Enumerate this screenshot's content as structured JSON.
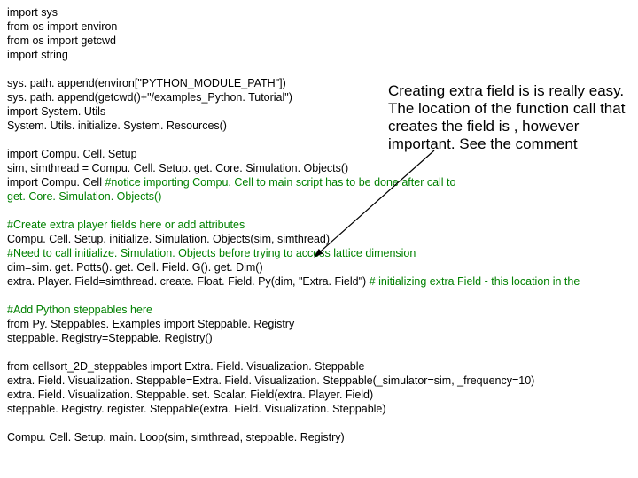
{
  "code": {
    "l1": "import sys",
    "l2": "from os import environ",
    "l3": "from os import getcwd",
    "l4": "import string",
    "l5": "",
    "l6": "sys. path. append(environ[\"PYTHON_MODULE_PATH\"])",
    "l7": "sys. path. append(getcwd()+\"/examples_Python. Tutorial\")",
    "l8": "import System. Utils",
    "l9": "System. Utils. initialize. System. Resources()",
    "l10": "",
    "l11": "import Compu. Cell. Setup",
    "l12": "sim, simthread = Compu. Cell. Setup. get. Core. Simulation. Objects()",
    "l13a": "import Compu. Cell ",
    "l13b": "#notice importing Compu. Cell to main script has to be done after call to ",
    "l14": "get. Core. Simulation. Objects()",
    "l15": "",
    "l16": "#Create extra player fields here or add attributes",
    "l17": "Compu. Cell. Setup. initialize. Simulation. Objects(sim, simthread)",
    "l18": "#Need to call initialize. Simulation. Objects before trying to access lattice dimension",
    "l19": "dim=sim. get. Potts(). get. Cell. Field. G(). get. Dim()",
    "l20a": "extra. Player. Field=simthread. create. Float. Field. Py(dim, \"Extra. Field\") ",
    "l20b": "# initializing extra Field - this location in the ",
    "l21": "",
    "l22": "#Add Python steppables here",
    "l23": "from Py. Steppables. Examples import Steppable. Registry",
    "l24": "steppable. Registry=Steppable. Registry()",
    "l25": "",
    "l26": "from cellsort_2D_steppables import Extra. Field. Visualization. Steppable",
    "l27": "extra. Field. Visualization. Steppable=Extra. Field. Visualization. Steppable(_simulator=sim, _frequency=10)",
    "l28": "extra. Field. Visualization. Steppable. set. Scalar. Field(extra. Player. Field)",
    "l29": "steppable. Registry. register. Steppable(extra. Field. Visualization. Steppable)",
    "l30": "",
    "l31": "Compu. Cell. Setup. main. Loop(sim, simthread, steppable. Registry)"
  },
  "callout": "Creating extra field is is really easy. The location of the function call that creates the field is , however important. See the comment"
}
